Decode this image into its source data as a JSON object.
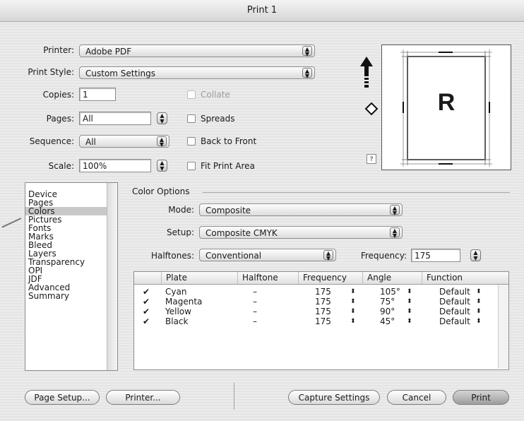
{
  "window": {
    "title": "Print 1"
  },
  "form": {
    "printer_label": "Printer:",
    "printer_value": "Adobe PDF",
    "print_style_label": "Print Style:",
    "print_style_value": "Custom Settings",
    "copies_label": "Copies:",
    "copies_value": "1",
    "pages_label": "Pages:",
    "pages_value": "All",
    "sequence_label": "Sequence:",
    "sequence_value": "All",
    "scale_label": "Scale:",
    "scale_value": "100%",
    "collate_label": "Collate",
    "spreads_label": "Spreads",
    "back_to_front_label": "Back to Front",
    "fit_print_area_label": "Fit Print Area"
  },
  "preview": {
    "letter": "R",
    "help": "?"
  },
  "categories": {
    "items": [
      "Device",
      "Pages",
      "Colors",
      "Pictures",
      "Fonts",
      "Marks",
      "Bleed",
      "Layers",
      "Transparency",
      "OPI",
      "JDF",
      "Advanced",
      "Summary"
    ],
    "selected": "Colors"
  },
  "color_options": {
    "group_title": "Color Options",
    "mode_label": "Mode:",
    "mode_value": "Composite",
    "setup_label": "Setup:",
    "setup_value": "Composite CMYK",
    "halftones_label": "Halftones:",
    "halftones_value": "Conventional",
    "frequency_label": "Frequency:",
    "frequency_value": "175"
  },
  "plates": {
    "headers": [
      "Plate",
      "Halftone",
      "Frequency",
      "Angle",
      "Function"
    ],
    "rows": [
      {
        "checked": true,
        "plate": "Cyan",
        "halftone": "–",
        "frequency": "175",
        "angle": "105°",
        "function": "Default"
      },
      {
        "checked": true,
        "plate": "Magenta",
        "halftone": "–",
        "frequency": "175",
        "angle": "75°",
        "function": "Default"
      },
      {
        "checked": true,
        "plate": "Yellow",
        "halftone": "–",
        "frequency": "175",
        "angle": "90°",
        "function": "Default"
      },
      {
        "checked": true,
        "plate": "Black",
        "halftone": "–",
        "frequency": "175",
        "angle": "45°",
        "function": "Default"
      }
    ]
  },
  "buttons": {
    "page_setup": "Page Setup...",
    "printer": "Printer...",
    "capture_settings": "Capture Settings",
    "cancel": "Cancel",
    "print": "Print"
  }
}
